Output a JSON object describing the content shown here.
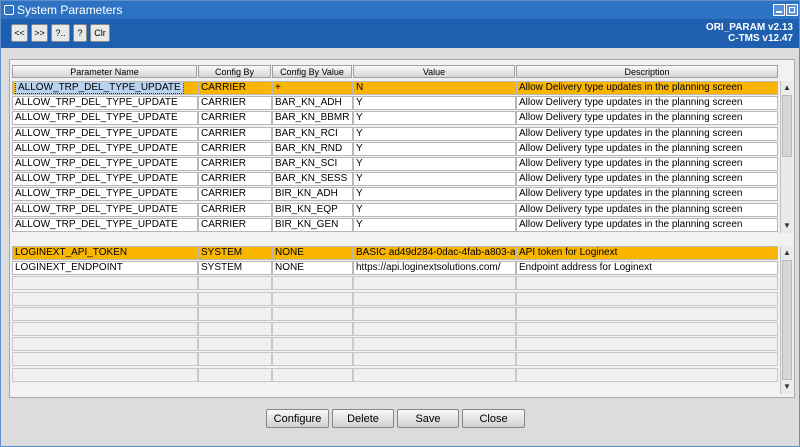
{
  "window": {
    "title": "System Parameters"
  },
  "header": {
    "nav_buttons": [
      "<<",
      ">>",
      "?..",
      "?",
      "Clr"
    ],
    "version_line1": "ORI_PARAM v2.13",
    "version_line2": "C-TMS v12.47"
  },
  "grid": {
    "columns": [
      "Parameter Name",
      "Config By",
      "Config By Value",
      "Value",
      "Description"
    ],
    "upper_rows": [
      [
        "ALLOW_TRP_DEL_TYPE_UPDATE",
        "CARRIER",
        "+",
        "N",
        "Allow Delivery type updates in the planning screen"
      ],
      [
        "ALLOW_TRP_DEL_TYPE_UPDATE",
        "CARRIER",
        "BAR_KN_ADH",
        "Y",
        "Allow Delivery type updates in the planning screen"
      ],
      [
        "ALLOW_TRP_DEL_TYPE_UPDATE",
        "CARRIER",
        "BAR_KN_BBMR",
        "Y",
        "Allow Delivery type updates in the planning screen"
      ],
      [
        "ALLOW_TRP_DEL_TYPE_UPDATE",
        "CARRIER",
        "BAR_KN_RCI",
        "Y",
        "Allow Delivery type updates in the planning screen"
      ],
      [
        "ALLOW_TRP_DEL_TYPE_UPDATE",
        "CARRIER",
        "BAR_KN_RND",
        "Y",
        "Allow Delivery type updates in the planning screen"
      ],
      [
        "ALLOW_TRP_DEL_TYPE_UPDATE",
        "CARRIER",
        "BAR_KN_SCI",
        "Y",
        "Allow Delivery type updates in the planning screen"
      ],
      [
        "ALLOW_TRP_DEL_TYPE_UPDATE",
        "CARRIER",
        "BAR_KN_SESS",
        "Y",
        "Allow Delivery type updates in the planning screen"
      ],
      [
        "ALLOW_TRP_DEL_TYPE_UPDATE",
        "CARRIER",
        "BIR_KN_ADH",
        "Y",
        "Allow Delivery type updates in the planning screen"
      ],
      [
        "ALLOW_TRP_DEL_TYPE_UPDATE",
        "CARRIER",
        "BIR_KN_EQP",
        "Y",
        "Allow Delivery type updates in the planning screen"
      ],
      [
        "ALLOW_TRP_DEL_TYPE_UPDATE",
        "CARRIER",
        "BIR_KN_GEN",
        "Y",
        "Allow Delivery type updates in the planning screen"
      ]
    ],
    "lower_rows": [
      [
        "LOGINEXT_API_TOKEN",
        "SYSTEM",
        "NONE",
        "BASIC ad49d284-0dac-4fab-a803-a",
        "API token for Loginext"
      ],
      [
        "LOGINEXT_ENDPOINT",
        "SYSTEM",
        "NONE",
        "https://api.loginextsolutions.com/",
        "Endpoint address for Loginext"
      ]
    ]
  },
  "actions": [
    "Configure",
    "Delete",
    "Save",
    "Close"
  ],
  "colors": {
    "title_bar": "#2e72c4",
    "header": "#1f5fb0",
    "highlight": "#f9b500"
  }
}
